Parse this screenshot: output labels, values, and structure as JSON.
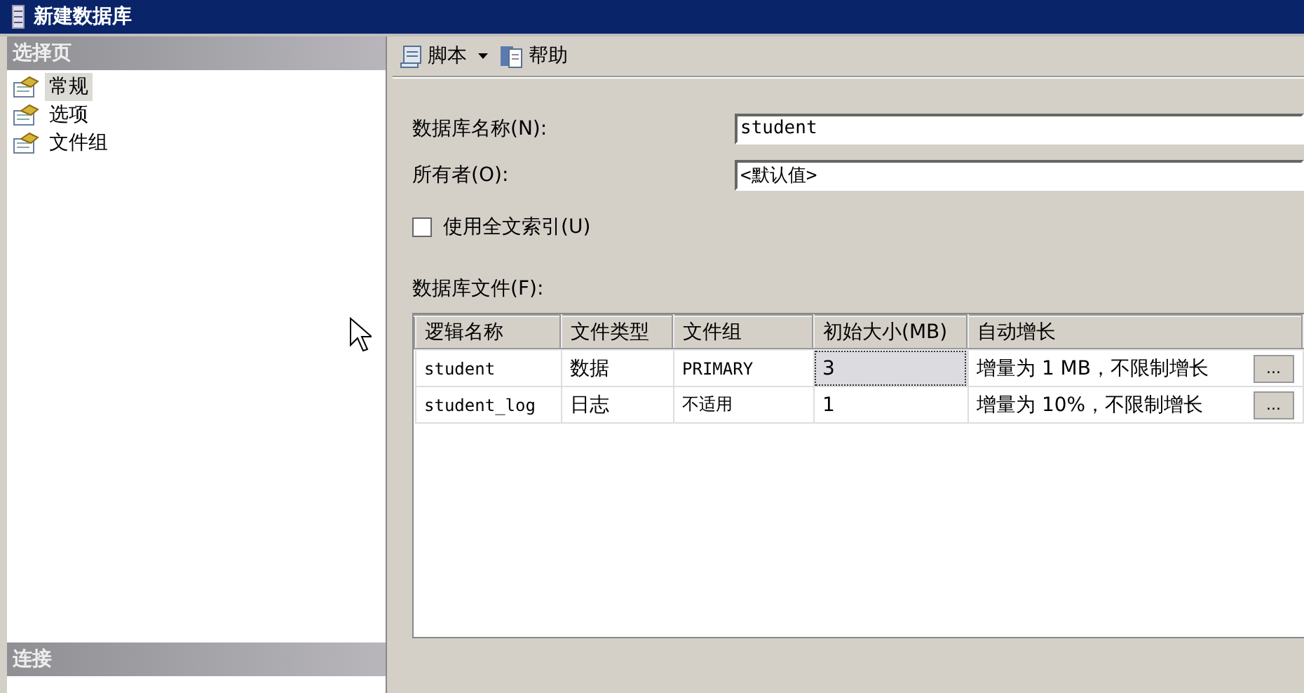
{
  "window": {
    "title": "新建数据库"
  },
  "sidebar": {
    "header": "选择页",
    "items": [
      {
        "label": "常规",
        "selected": true
      },
      {
        "label": "选项",
        "selected": false
      },
      {
        "label": "文件组",
        "selected": false
      }
    ],
    "footer": "连接"
  },
  "toolbar": [
    {
      "label": "脚本",
      "kind": "dropdown"
    },
    {
      "label": "帮助",
      "kind": "button"
    }
  ],
  "fields": [
    {
      "label": "数据库名称(N):",
      "value": "student"
    },
    {
      "label": "所有者(O):",
      "value": "<默认值>"
    }
  ],
  "fulltext_checkbox": {
    "label": "使用全文索引(U)",
    "checked": false
  },
  "files": {
    "label": "数据库文件(F):",
    "columns": [
      "逻辑名称",
      "文件类型",
      "文件组",
      "初始大小(MB)",
      "自动增长"
    ],
    "rows": [
      {
        "logical_name": "student",
        "file_type": "数据",
        "filegroup": "PRIMARY",
        "initial_size": "3",
        "autogrowth": "增量为 1 MB，不限制增长",
        "browse_button": "...",
        "size_focused": true
      },
      {
        "logical_name": "student_log",
        "file_type": "日志",
        "filegroup": "不适用",
        "initial_size": "1",
        "autogrowth": "增量为 10%，不限制增长",
        "browse_button": "...",
        "size_focused": false
      }
    ]
  }
}
